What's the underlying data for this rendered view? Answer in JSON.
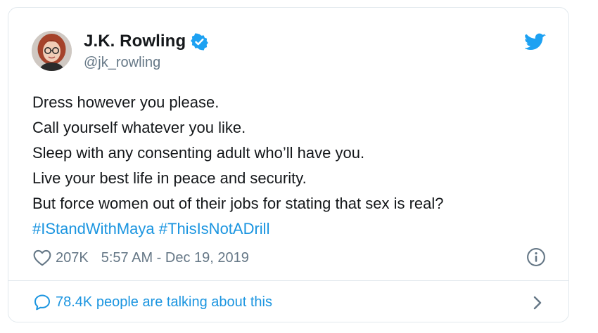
{
  "author": {
    "display_name": "J.K. Rowling",
    "handle": "@jk_rowling",
    "verified": true
  },
  "tweet": {
    "lines": [
      "Dress however you please.",
      "Call yourself whatever you like.",
      "Sleep with any consenting adult who’ll have you.",
      "Live your best life in peace and security.",
      "But force women out of their jobs for stating that sex is real?"
    ],
    "hashtags": [
      "#IStandWithMaya",
      "#ThisIsNotADrill"
    ]
  },
  "meta": {
    "likes": "207K",
    "timestamp": "5:57 AM - Dec 19, 2019"
  },
  "conversation": {
    "label": "78.4K people are talking about this"
  },
  "icons": {
    "brand": "twitter-bird-icon",
    "verified": "verified-badge-icon",
    "like": "heart-icon",
    "info": "info-icon",
    "reply": "speech-bubble-icon",
    "chevron": "chevron-right-icon"
  },
  "colors": {
    "brand_blue": "#1da1f2",
    "link_blue": "#1b95e0",
    "text": "#14171a",
    "muted": "#657786",
    "border": "#e1e8ed"
  }
}
